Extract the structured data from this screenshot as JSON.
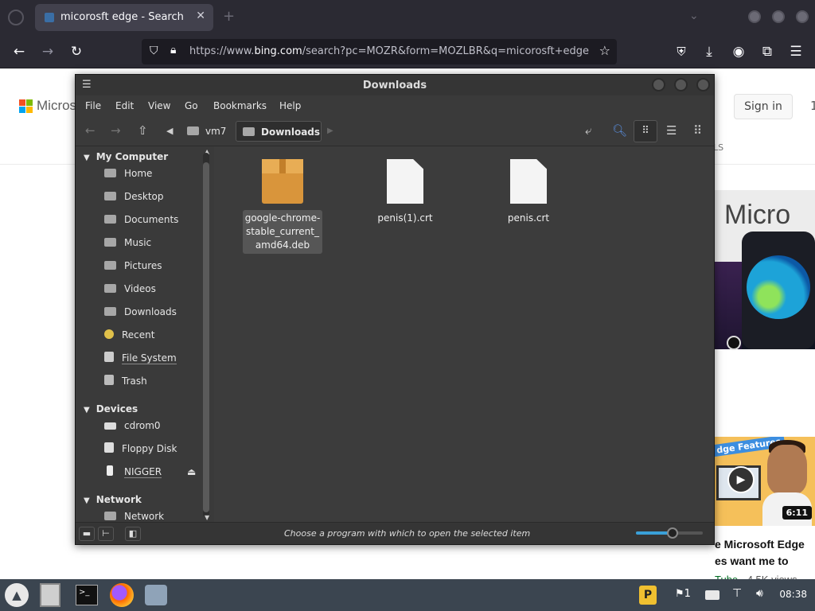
{
  "browser": {
    "tab_title": "micorosft edge - Search",
    "url_prefix": "https://www.",
    "url_host": "bing.com",
    "url_rest": "/search?pc=MOZR&form=MOZLBR&q=micorosft+edge"
  },
  "bing": {
    "logo_text": "Microso",
    "sign_in": "Sign in",
    "ls_tab": "LS",
    "video_title_line1": "e Microsoft Edge",
    "video_title_line2": "es want me to",
    "video_source": "Tube",
    "video_views": " · 4.5K views",
    "video_duration": "6:11",
    "card_micro_text": "Micro",
    "banner": "dge Features"
  },
  "file_manager": {
    "title": "Downloads",
    "menus": [
      "File",
      "Edit",
      "View",
      "Go",
      "Bookmarks",
      "Help"
    ],
    "breadcrumbs": [
      "vm7",
      "Downloads"
    ],
    "sidebar": {
      "sections": [
        {
          "label": "My Computer",
          "items": [
            "Home",
            "Desktop",
            "Documents",
            "Music",
            "Pictures",
            "Videos",
            "Downloads",
            "Recent",
            "File System",
            "Trash"
          ]
        },
        {
          "label": "Devices",
          "items": [
            "cdrom0",
            "Floppy Disk",
            "NIGGER"
          ]
        },
        {
          "label": "Network",
          "items": [
            "Network"
          ]
        }
      ]
    },
    "files": [
      {
        "name": "google-chrome-stable_current_amd64.deb",
        "line1": "google-chrome-",
        "line2": "stable_current_",
        "line3": "amd64.deb",
        "kind": "package-icon"
      },
      {
        "name": "penis(1).crt",
        "kind": "document-icon"
      },
      {
        "name": "penis.crt",
        "kind": "document-icon"
      }
    ],
    "status": "Choose a program with which to open the selected item",
    "zoom_level": 0.55
  },
  "taskbar": {
    "clock": "08:38",
    "notifications": "1"
  },
  "colors": {
    "accent": "#3aa0d8",
    "fm_bg": "#3c3c3c",
    "taskbar": "#3b4550"
  }
}
